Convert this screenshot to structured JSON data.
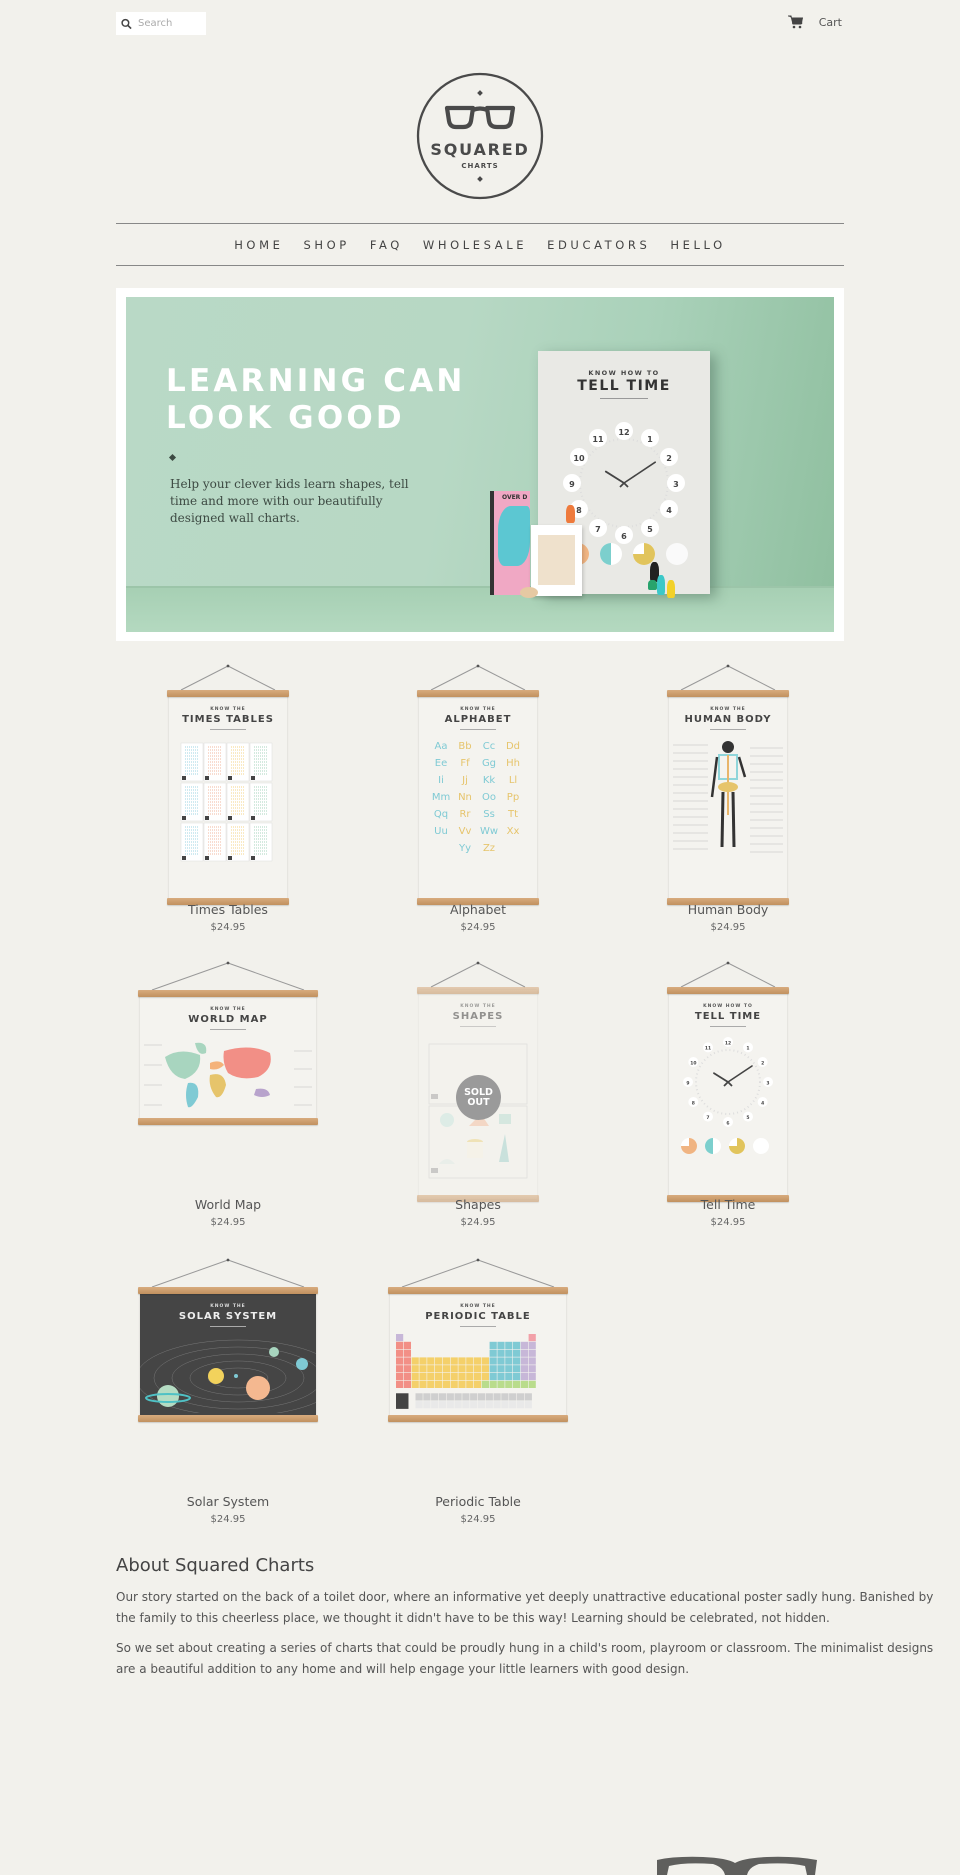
{
  "header": {
    "search_placeholder": "Search",
    "cart_label": "Cart",
    "logo": {
      "brand": "SQUARED",
      "sub": "CHARTS"
    }
  },
  "nav": {
    "items": [
      {
        "label": "HOME"
      },
      {
        "label": "SHOP"
      },
      {
        "label": "FAQ"
      },
      {
        "label": "WHOLESALE"
      },
      {
        "label": "EDUCATORS"
      },
      {
        "label": "HELLO"
      }
    ]
  },
  "hero": {
    "title_line1": "LEARNING CAN",
    "title_line2": "LOOK GOOD",
    "subtitle": "Help your clever kids learn shapes, tell time and more with our beautifully designed wall charts.",
    "poster_know": "KNOW HOW TO",
    "poster_title": "TELL TIME",
    "clock_numbers": [
      "12",
      "1",
      "2",
      "3",
      "4",
      "5",
      "6",
      "7",
      "8",
      "9",
      "10",
      "11"
    ],
    "book_title": "OVER D"
  },
  "products": [
    {
      "name": "Times Tables",
      "price": "$24.95",
      "know": "KNOW THE",
      "title": "TIMES TABLES",
      "sold_out": false
    },
    {
      "name": "Alphabet",
      "price": "$24.95",
      "know": "KNOW THE",
      "title": "ALPHABET",
      "sold_out": false
    },
    {
      "name": "Human Body",
      "price": "$24.95",
      "know": "KNOW THE",
      "title": "HUMAN BODY",
      "sold_out": false
    },
    {
      "name": "World Map",
      "price": "$24.95",
      "know": "KNOW THE",
      "title": "WORLD MAP",
      "sold_out": false
    },
    {
      "name": "Shapes",
      "price": "$24.95",
      "know": "KNOW THE",
      "title": "SHAPES",
      "sold_out": true,
      "sold_out_label": "SOLD OUT"
    },
    {
      "name": "Tell Time",
      "price": "$24.95",
      "know": "KNOW HOW TO",
      "title": "TELL TIME",
      "sold_out": false
    },
    {
      "name": "Solar System",
      "price": "$24.95",
      "know": "KNOW THE",
      "title": "SOLAR SYSTEM",
      "sold_out": false
    },
    {
      "name": "Periodic Table",
      "price": "$24.95",
      "know": "KNOW THE",
      "title": "PERIODIC TABLE",
      "sold_out": false
    }
  ],
  "alphabet_letters": [
    "Aa",
    "Bb",
    "Cc",
    "Dd",
    "Ee",
    "Ff",
    "Gg",
    "Hh",
    "Ii",
    "Jj",
    "Kk",
    "Ll",
    "Mm",
    "Nn",
    "Oo",
    "Pp",
    "Qq",
    "Rr",
    "Ss",
    "Tt",
    "Uu",
    "Vv",
    "Ww",
    "Xx",
    "Yy",
    "Zz"
  ],
  "about": {
    "heading": "About Squared Charts",
    "paragraph1": "Our story started on the back of a toilet door, where an informative yet deeply unattractive educational poster sadly hung. Banished by the family to this cheerless place, we thought it didn't have to be this way! Learning should be celebrated, not hidden.",
    "paragraph2": "So we set about creating a series of charts that could be proudly hung in a child's room, playroom or classroom. The minimalist designs are a beautiful addition to any home and will help engage your little learners with good design."
  },
  "colors": {
    "background": "#f2f1ec",
    "hero_green": "#b7d8c4",
    "text_dark": "#444444",
    "wood": "#c99a6a",
    "sold_out_badge": "#9a9a9a"
  }
}
